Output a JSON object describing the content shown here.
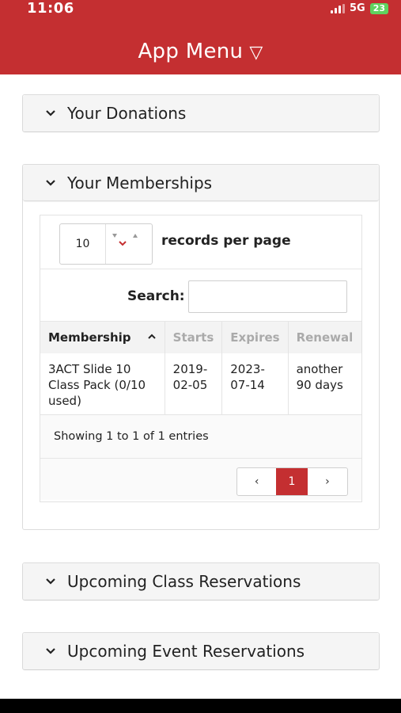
{
  "status_bar": {
    "time": "11:06",
    "network": "5G",
    "battery": "23"
  },
  "header": {
    "title": "App Menu"
  },
  "sections": {
    "donations": {
      "label": "Your Donations"
    },
    "memberships": {
      "label": "Your Memberships"
    },
    "class_reservations": {
      "label": "Upcoming Class Reservations"
    },
    "event_reservations": {
      "label": "Upcoming Event Reservations"
    }
  },
  "table_controls": {
    "page_length": "10",
    "page_length_label": "records per page",
    "search_label": "Search:",
    "search_value": ""
  },
  "table": {
    "columns": [
      "Membership",
      "Starts",
      "Expires",
      "Renewal"
    ],
    "rows": [
      {
        "membership": "3ACT Slide 10 Class Pack (0/10 used)",
        "starts": "2019-02-05",
        "expires": "2023-07-14",
        "renewal": "another 90 days"
      }
    ],
    "info": "Showing 1 to 1 of 1 entries"
  },
  "pagination": {
    "prev": "‹",
    "current": "1",
    "next": "›"
  },
  "colors": {
    "brand_red": "#c42f31",
    "panel_heading_bg": "#f5f5f5",
    "muted_header_text": "#aaaaaa"
  },
  "icons": [
    "signal-icon",
    "battery-icon",
    "dropdown-triangle-icon",
    "chevron-down-icon",
    "sort-ascending-icon",
    "stepper-arrows-icon"
  ]
}
